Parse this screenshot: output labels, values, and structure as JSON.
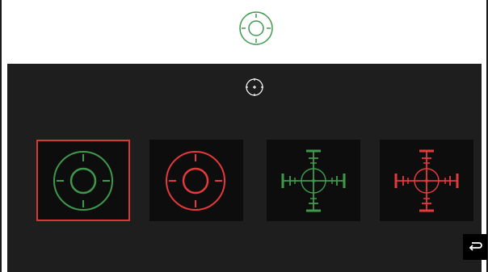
{
  "colors": {
    "green": "#3e9a4b",
    "red": "#e6393b",
    "dark_panel": "#1e1e1e",
    "tile_bg": "#0d0d0d",
    "selection_border": "#d63a35",
    "white": "#ffffff"
  },
  "preview": {
    "icon": "crosshair-circle-green-icon"
  },
  "center_marker": {
    "icon": "crosshair-small-white-icon"
  },
  "reticle_options": [
    {
      "icon": "reticle-circle-green-icon",
      "selected": true
    },
    {
      "icon": "reticle-circle-red-icon",
      "selected": false
    },
    {
      "icon": "reticle-cross-green-icon",
      "selected": false
    },
    {
      "icon": "reticle-cross-red-icon",
      "selected": false
    }
  ],
  "back_button": {
    "icon": "return-arrow-icon"
  }
}
